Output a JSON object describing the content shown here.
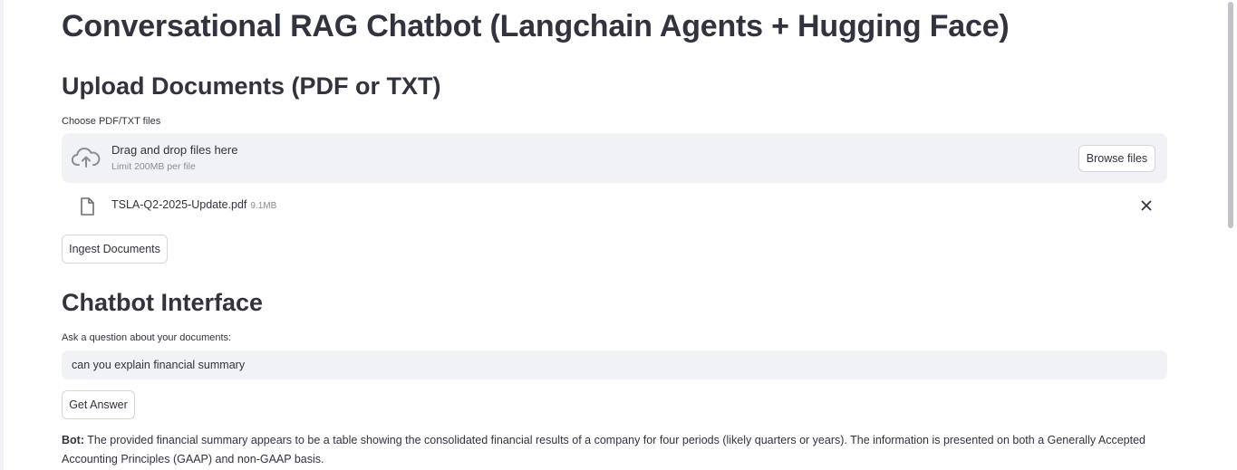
{
  "app": {
    "title": "Conversational RAG Chatbot (Langchain Agents + Hugging Face)"
  },
  "upload_section": {
    "title": "Upload Documents (PDF or TXT)",
    "uploader_label": "Choose PDF/TXT files",
    "dropzone": {
      "title": "Drag and drop files here",
      "limit": "Limit 200MB per file",
      "icon": "cloud-upload-icon",
      "browse_label": "Browse files"
    },
    "file": {
      "name": "TSLA-Q2-2025-Update.pdf",
      "size": "9.1MB",
      "icon": "file-icon",
      "remove_icon": "close-icon"
    },
    "ingest_label": "Ingest Documents"
  },
  "chat_section": {
    "title": "Chatbot Interface",
    "question_label": "Ask a question about your documents:",
    "question_value": "can you explain financial summary",
    "answer_button_label": "Get Answer",
    "bot_prefix": "Bot:",
    "bot_answer": "The provided financial summary appears to be a table showing the consolidated financial results of a company for four periods (likely quarters or years). The information is presented on both a Generally Accepted Accounting Principles (GAAP) and non-GAAP basis."
  },
  "colors": {
    "text": "#31333f",
    "muted": "#8b8d96",
    "widget_bg": "#f0f2f6",
    "border": "#d4d6dc"
  }
}
